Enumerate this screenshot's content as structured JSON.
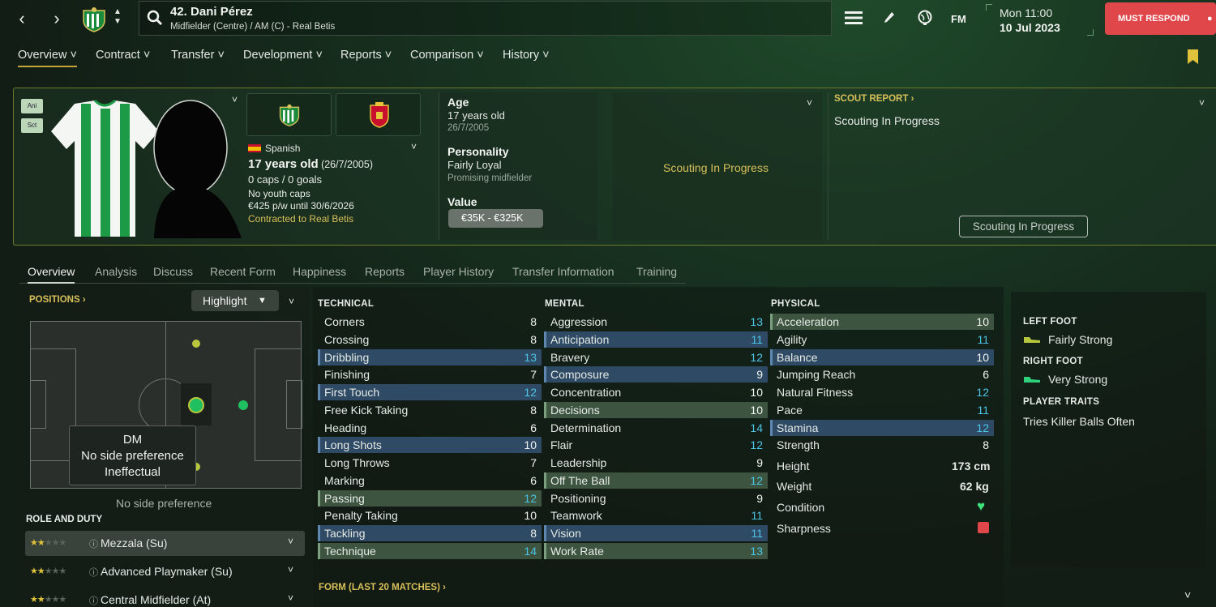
{
  "header": {
    "player_title": "42. Dani Pérez",
    "player_subtitle": "Midfielder (Centre) / AM (C) - Real Betis",
    "fm_label": "FM",
    "day_time": "Mon 11:00",
    "date": "10 Jul 2023",
    "must_respond": "MUST RESPOND"
  },
  "main_nav": [
    "Overview",
    "Contract",
    "Transfer",
    "Development",
    "Reports",
    "Comparison",
    "History"
  ],
  "profile": {
    "ani_label": "Ani",
    "sct_label": "Sct",
    "nationality": "Spanish",
    "age_main": "17 years old",
    "age_dob": "(26/7/2005)",
    "caps": "0 caps / 0 goals",
    "youth_caps": "No youth caps",
    "wage": "€425 p/w until 30/6/2026",
    "contract": "Contracted to Real Betis",
    "age_label": "Age",
    "age_value": "17 years old",
    "dob": "26/7/2005",
    "personality_label": "Personality",
    "personality_value": "Fairly Loyal",
    "personality_sub": "Promising midfielder",
    "value_label": "Value",
    "value_range": "€35K - €325K",
    "scouting_center": "Scouting In Progress",
    "scout_report_title": "SCOUT REPORT",
    "scout_report_text": "Scouting In Progress",
    "scout_button": "Scouting In Progress"
  },
  "sub_tabs": [
    "Overview",
    "Analysis",
    "Discuss",
    "Recent Form",
    "Happiness",
    "Reports",
    "Player History",
    "Transfer Information",
    "Training"
  ],
  "positions": {
    "title": "POSITIONS",
    "highlight_label": "Highlight",
    "tooltip_pos": "DM",
    "tooltip_side": "No side preference",
    "tooltip_rating": "Ineffectual",
    "side_text": "No side preference"
  },
  "roles": {
    "title": "ROLE AND DUTY",
    "items": [
      {
        "name": "Mezzala (Su)"
      },
      {
        "name": "Advanced Playmaker (Su)"
      },
      {
        "name": "Central Midfielder (At)"
      }
    ]
  },
  "technical": {
    "title": "TECHNICAL",
    "items": [
      {
        "name": "Corners",
        "value": "8",
        "hl": "",
        "color": "w"
      },
      {
        "name": "Crossing",
        "value": "8",
        "hl": "",
        "color": "w"
      },
      {
        "name": "Dribbling",
        "value": "13",
        "hl": "hb",
        "color": "c"
      },
      {
        "name": "Finishing",
        "value": "7",
        "hl": "",
        "color": "w"
      },
      {
        "name": "First Touch",
        "value": "12",
        "hl": "hb",
        "color": "c"
      },
      {
        "name": "Free Kick Taking",
        "value": "8",
        "hl": "",
        "color": "w"
      },
      {
        "name": "Heading",
        "value": "6",
        "hl": "",
        "color": "w"
      },
      {
        "name": "Long Shots",
        "value": "10",
        "hl": "hb",
        "color": "w"
      },
      {
        "name": "Long Throws",
        "value": "7",
        "hl": "",
        "color": "w"
      },
      {
        "name": "Marking",
        "value": "6",
        "hl": "",
        "color": "w"
      },
      {
        "name": "Passing",
        "value": "12",
        "hl": "hg",
        "color": "c"
      },
      {
        "name": "Penalty Taking",
        "value": "10",
        "hl": "",
        "color": "w"
      },
      {
        "name": "Tackling",
        "value": "8",
        "hl": "hb",
        "color": "w"
      },
      {
        "name": "Technique",
        "value": "14",
        "hl": "hg",
        "color": "c"
      }
    ]
  },
  "mental": {
    "title": "MENTAL",
    "items": [
      {
        "name": "Aggression",
        "value": "13",
        "hl": "",
        "color": "c"
      },
      {
        "name": "Anticipation",
        "value": "11",
        "hl": "hb",
        "color": "c"
      },
      {
        "name": "Bravery",
        "value": "12",
        "hl": "",
        "color": "c"
      },
      {
        "name": "Composure",
        "value": "9",
        "hl": "hb",
        "color": "w"
      },
      {
        "name": "Concentration",
        "value": "10",
        "hl": "",
        "color": "w"
      },
      {
        "name": "Decisions",
        "value": "10",
        "hl": "hg",
        "color": "w"
      },
      {
        "name": "Determination",
        "value": "14",
        "hl": "",
        "color": "c"
      },
      {
        "name": "Flair",
        "value": "12",
        "hl": "",
        "color": "c"
      },
      {
        "name": "Leadership",
        "value": "9",
        "hl": "",
        "color": "w"
      },
      {
        "name": "Off The Ball",
        "value": "12",
        "hl": "hg",
        "color": "c"
      },
      {
        "name": "Positioning",
        "value": "9",
        "hl": "",
        "color": "w"
      },
      {
        "name": "Teamwork",
        "value": "11",
        "hl": "",
        "color": "c"
      },
      {
        "name": "Vision",
        "value": "11",
        "hl": "hb",
        "color": "c"
      },
      {
        "name": "Work Rate",
        "value": "13",
        "hl": "hg",
        "color": "c"
      }
    ]
  },
  "physical": {
    "title": "PHYSICAL",
    "items": [
      {
        "name": "Acceleration",
        "value": "10",
        "hl": "hg",
        "color": "w"
      },
      {
        "name": "Agility",
        "value": "11",
        "hl": "",
        "color": "c"
      },
      {
        "name": "Balance",
        "value": "10",
        "hl": "hb",
        "color": "w"
      },
      {
        "name": "Jumping Reach",
        "value": "6",
        "hl": "",
        "color": "w"
      },
      {
        "name": "Natural Fitness",
        "value": "12",
        "hl": "",
        "color": "c"
      },
      {
        "name": "Pace",
        "value": "11",
        "hl": "",
        "color": "c"
      },
      {
        "name": "Stamina",
        "value": "12",
        "hl": "hb",
        "color": "c"
      },
      {
        "name": "Strength",
        "value": "8",
        "hl": "",
        "color": "w"
      }
    ],
    "height_label": "Height",
    "height_value": "173 cm",
    "weight_label": "Weight",
    "weight_value": "62 kg",
    "condition_label": "Condition",
    "sharpness_label": "Sharpness"
  },
  "side_info": {
    "left_foot_title": "LEFT FOOT",
    "left_foot_value": "Fairly Strong",
    "right_foot_title": "RIGHT FOOT",
    "right_foot_value": "Very Strong",
    "traits_title": "PLAYER TRAITS",
    "trait_1": "Tries Killer Balls Often"
  },
  "form_title": "FORM (LAST 20 MATCHES)",
  "colors": {
    "accent_gold": "#c5a53a",
    "must_respond_red": "#e0474b",
    "cyan_value": "#4cc4e6",
    "highlight_blue": "#2f4a64",
    "highlight_green": "#3d5540"
  }
}
